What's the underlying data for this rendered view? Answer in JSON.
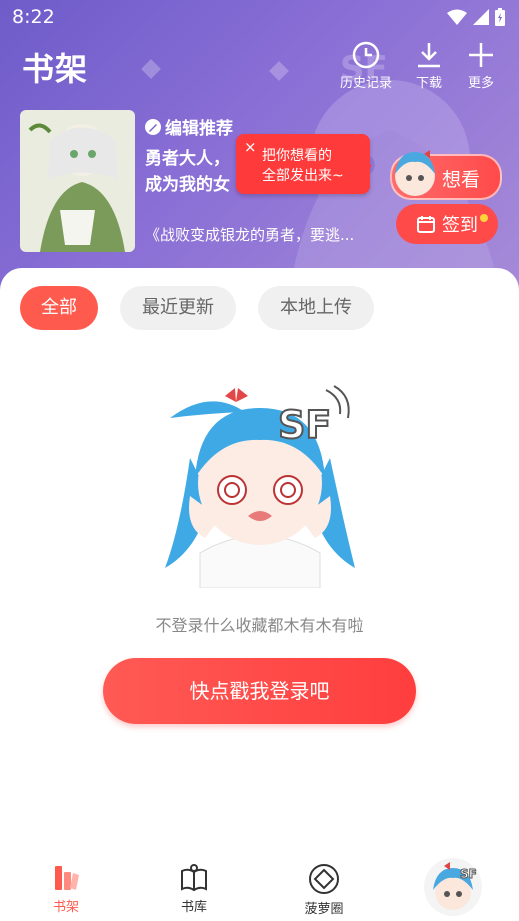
{
  "status_bar": {
    "time": "8:22"
  },
  "header": {
    "title": "书架",
    "actions": [
      {
        "label": "历史记录",
        "icon": "clock-icon"
      },
      {
        "label": "下载",
        "icon": "download-icon"
      },
      {
        "label": "更多",
        "icon": "plus-icon"
      }
    ]
  },
  "recommend": {
    "tag": "编辑推荐",
    "title_line1": "勇者大人，",
    "title_line2": "成为我的女",
    "subtitle": "《战败变成银龙的勇者，要逃..."
  },
  "tooltip": {
    "close": "×",
    "line1": "把你想看的",
    "line2": "全部发出来~"
  },
  "want_button": {
    "label": "想看"
  },
  "sign_button": {
    "label": "签到"
  },
  "tabs": [
    {
      "label": "全部",
      "active": true
    },
    {
      "label": "最近更新",
      "active": false
    },
    {
      "label": "本地上传",
      "active": false
    }
  ],
  "empty_state": {
    "message": "不登录什么收藏都木有木有啦",
    "login_button": "快点戳我登录吧"
  },
  "bottom_nav": [
    {
      "label": "书架",
      "icon": "bookshelf-icon",
      "active": true
    },
    {
      "label": "书库",
      "icon": "book-icon",
      "active": false
    },
    {
      "label": "菠萝圈",
      "icon": "community-icon",
      "active": false
    }
  ],
  "colors": {
    "accent": "#ff5a4e",
    "header_purple": "#7b63cf"
  }
}
